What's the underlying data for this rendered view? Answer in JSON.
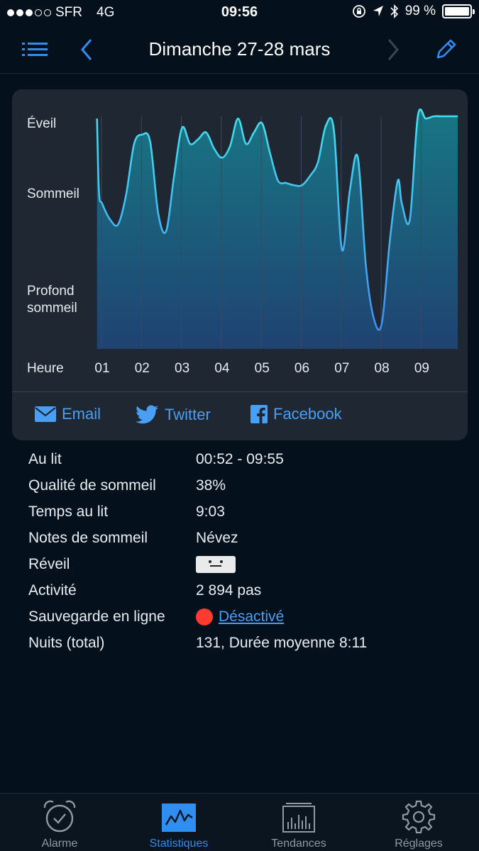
{
  "status": {
    "carrier": "SFR",
    "network": "4G",
    "time": "09:56",
    "battery": "99 %"
  },
  "nav": {
    "title": "Dimanche 27-28 mars",
    "icons": [
      "list-icon",
      "chevron-left-icon",
      "chevron-right-icon",
      "pencil-icon"
    ]
  },
  "chart_data": {
    "type": "area",
    "y_levels": [
      "Éveil",
      "Sommeil",
      "Profond sommeil"
    ],
    "x_axis_label": "Heure",
    "x_ticks": [
      "01",
      "02",
      "03",
      "04",
      "05",
      "06",
      "07",
      "08",
      "09"
    ],
    "x": [
      0.87,
      0.92,
      1.0,
      1.2,
      1.4,
      1.6,
      1.8,
      2.0,
      2.2,
      2.4,
      2.6,
      2.8,
      3.0,
      3.2,
      3.4,
      3.6,
      3.8,
      4.0,
      4.2,
      4.4,
      4.6,
      4.8,
      5.0,
      5.2,
      5.4,
      5.6,
      5.8,
      6.0,
      6.2,
      6.4,
      6.6,
      6.8,
      7.0,
      7.2,
      7.4,
      7.6,
      7.8,
      8.0,
      8.2,
      8.4,
      8.5,
      8.7,
      8.9,
      9.1,
      9.3,
      9.5,
      9.7,
      9.9
    ],
    "level": [
      0.99,
      0.67,
      0.62,
      0.55,
      0.53,
      0.66,
      0.88,
      0.92,
      0.89,
      0.58,
      0.5,
      0.74,
      0.95,
      0.88,
      0.9,
      0.93,
      0.86,
      0.82,
      0.87,
      0.99,
      0.88,
      0.93,
      0.97,
      0.84,
      0.72,
      0.71,
      0.7,
      0.7,
      0.74,
      0.8,
      0.96,
      0.94,
      0.42,
      0.68,
      0.82,
      0.35,
      0.12,
      0.1,
      0.46,
      0.72,
      0.62,
      0.55,
      1.0,
      0.99,
      1.0,
      1.0,
      1.0,
      1.0
    ]
  },
  "share": {
    "email": "Email",
    "twitter": "Twitter",
    "facebook": "Facebook"
  },
  "stats": {
    "in_bed_label": "Au lit",
    "in_bed_value": "00:52 - 09:55",
    "quality_label": "Qualité de sommeil",
    "quality_value": "38%",
    "time_in_bed_label": "Temps au lit",
    "time_in_bed_value": "9:03",
    "notes_label": "Notes de sommeil",
    "notes_value": "Névez",
    "wakeup_label": "Réveil",
    "wakeup_mood_icon": "neutral-face-icon",
    "activity_label": "Activité",
    "activity_value": "2 894 pas",
    "backup_label": "Sauvegarde en ligne",
    "backup_value": "Désactivé",
    "backup_status_color": "#ff3b30",
    "nights_label": "Nuits (total)",
    "nights_value": "131, Durée moyenne 8:11"
  },
  "tabs": [
    {
      "label": "Alarme",
      "icon": "alarm-clock-icon",
      "active": false
    },
    {
      "label": "Statistiques",
      "icon": "graph-icon",
      "active": true
    },
    {
      "label": "Tendances",
      "icon": "histogram-icon",
      "active": false
    },
    {
      "label": "Réglages",
      "icon": "gear-icon",
      "active": false
    }
  ],
  "colors": {
    "accent": "#2f8ef0",
    "line": "#3fd2ec",
    "background": "#04111d",
    "card": "#1e2732"
  }
}
